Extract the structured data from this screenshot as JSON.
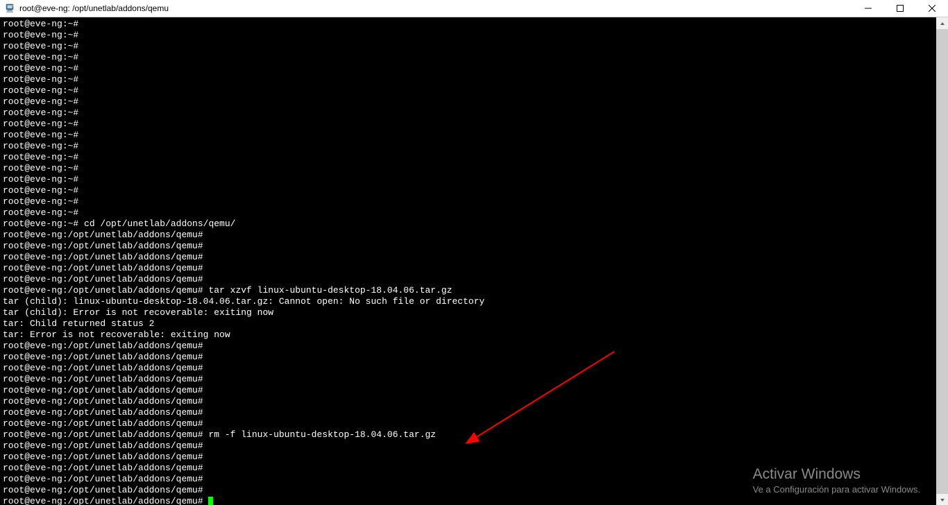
{
  "window": {
    "title": "root@eve-ng: /opt/unetlab/addons/qemu"
  },
  "terminal": {
    "prompt_home": "root@eve-ng:~#",
    "prompt_qemu": "root@eve-ng:/opt/unetlab/addons/qemu#",
    "cmd_cd": "cd /opt/unetlab/addons/qemu/",
    "cmd_tar": "tar xzvf linux-ubuntu-desktop-18.04.06.tar.gz",
    "cmd_rm": "rm -f linux-ubuntu-desktop-18.04.06.tar.gz",
    "err1": "tar (child): linux-ubuntu-desktop-18.04.06.tar.gz: Cannot open: No such file or directory",
    "err2": "tar (child): Error is not recoverable: exiting now",
    "err3": "tar: Child returned status 2",
    "err4": "tar: Error is not recoverable: exiting now"
  },
  "watermark": {
    "title": "Activar Windows",
    "sub": "Ve a Configuración para activar Windows."
  }
}
